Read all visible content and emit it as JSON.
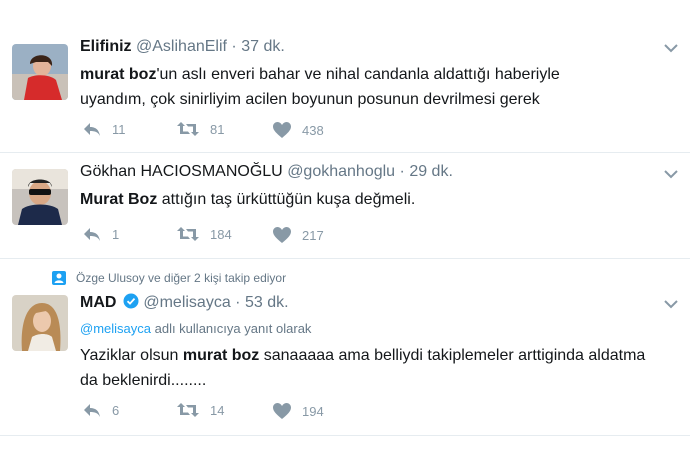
{
  "tweets": [
    {
      "name": "Elifiniz",
      "handle": "@AslihanElif",
      "dot": "·",
      "time": "37 dk.",
      "text_bold": "murat boz",
      "text_rest": "'un aslı enveri bahar ve nihal candanla aldattığı haberiyle",
      "text_line2": "uyandım, çok sinirliyim acilen boyunun posunun devrilmesi gerek",
      "reply_count": "11",
      "retweet_count": "81",
      "like_count": "438"
    },
    {
      "name": "Gökhan HACIOSMANOĞLU",
      "handle": "@gokhanhoglu",
      "dot": "·",
      "time": "29 dk.",
      "text_bold": "Murat Boz",
      "text_rest": " attığın taş ürküttüğün kuşa değmeli.",
      "reply_count": "1",
      "retweet_count": "184",
      "like_count": "217"
    },
    {
      "context": "Özge Ulusoy ve diğer 2 kişi takip ediyor",
      "name": "MAD",
      "handle": "@melisayca",
      "dot": "·",
      "time": "53 dk.",
      "reply_mention": "@melisayca",
      "reply_rest": " adlı kullanıcıya yanıt olarak",
      "text_pre": "Yaziklar olsun ",
      "text_bold": "murat boz",
      "text_rest": " sanaaaaa ama belliydi takiplemeler arttiginda aldatma",
      "text_line2": "da beklenirdi........",
      "reply_count": "6",
      "retweet_count": "14",
      "like_count": "194"
    }
  ],
  "colors": {
    "icon_gray": "#8899a6",
    "link_blue": "#1da1f2",
    "border": "#e6ecf0"
  },
  "icons": [
    "reply-icon",
    "retweet-icon",
    "heart-icon",
    "chevron-down-icon",
    "verified-icon",
    "follow-context-icon"
  ]
}
